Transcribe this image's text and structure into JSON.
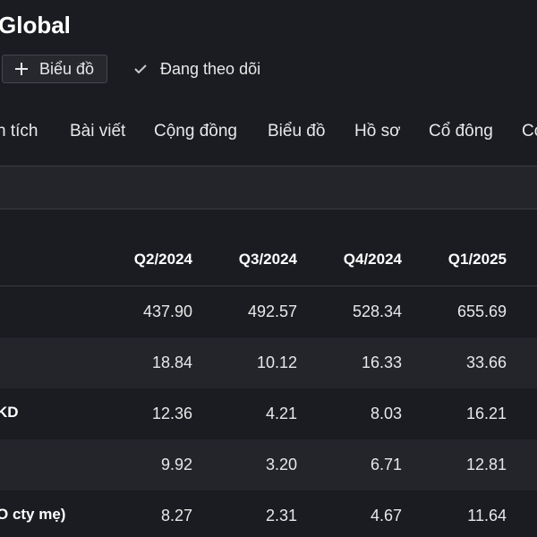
{
  "header": {
    "title": "Global",
    "chart_button_label": "Biểu đồ",
    "chart_button_icon": "plus-icon",
    "follow_label": "Đang theo dõi",
    "follow_icon": "check-icon"
  },
  "tabs": [
    {
      "label": "n tích"
    },
    {
      "label": "Bài viết"
    },
    {
      "label": "Cộng đồng"
    },
    {
      "label": "Biểu đồ"
    },
    {
      "label": "Hồ sơ"
    },
    {
      "label": "Cổ đông"
    },
    {
      "label": "Cơ"
    }
  ],
  "table": {
    "columns": [
      "Q2/2024",
      "Q3/2024",
      "Q4/2024",
      "Q1/2025"
    ],
    "rows": [
      {
        "label": "",
        "values": [
          "437.90",
          "492.57",
          "528.34",
          "655.69"
        ]
      },
      {
        "label": "",
        "values": [
          "18.84",
          "10.12",
          "16.33",
          "33.66"
        ]
      },
      {
        "label": "KD",
        "values": [
          "12.36",
          "4.21",
          "8.03",
          "16.21"
        ]
      },
      {
        "label": "",
        "values": [
          "9.92",
          "3.20",
          "6.71",
          "12.81"
        ]
      },
      {
        "label": "O cty mẹ)",
        "values": [
          "8.27",
          "2.31",
          "4.67",
          "11.64"
        ]
      }
    ]
  },
  "colors": {
    "background": "#1b1c21",
    "row_alt": "#24252b",
    "text": "#e8e8ea",
    "divider": "#3a3c43"
  }
}
